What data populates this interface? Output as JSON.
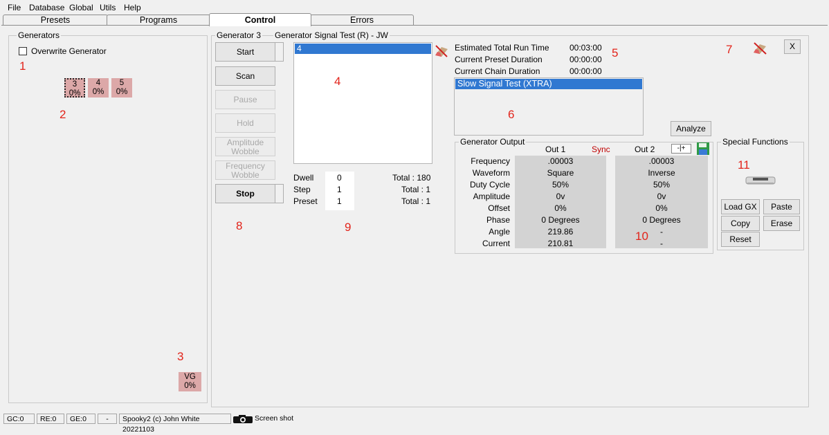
{
  "menu": [
    "File",
    "Database",
    "Global",
    "Utils",
    "Help"
  ],
  "tabs": [
    "Presets",
    "Programs",
    "Control",
    "Errors"
  ],
  "generators_panel": {
    "title": "Generators",
    "overwrite_label": "Overwrite Generator",
    "tiles": [
      {
        "num": "3",
        "pct": "0%"
      },
      {
        "num": "4",
        "pct": "0%"
      },
      {
        "num": "5",
        "pct": "0%"
      }
    ],
    "vg": {
      "num": "VG",
      "pct": "0%"
    }
  },
  "control": {
    "generator_title": "Generator 3",
    "program_title": "Generator Signal Test (R) - JW",
    "buttons": {
      "start": "Start",
      "scan": "Scan",
      "pause": "Pause",
      "hold": "Hold",
      "amp_1": "Amplitude",
      "amp_2": "Wobble",
      "freq_1": "Frequency",
      "freq_2": "Wobble",
      "stop": "Stop"
    },
    "list_selected": "4",
    "counters": {
      "dwell_label": "Dwell",
      "dwell_value": "0",
      "dwell_total": "Total : 180",
      "step_label": "Step",
      "step_value": "1",
      "step_total": "Total : 1",
      "preset_label": "Preset",
      "preset_value": "1",
      "preset_total": "Total : 1"
    }
  },
  "runtime": {
    "total_label": "Estimated Total Run Time",
    "total_value": "00:03:00",
    "preset_label": "Current Preset Duration",
    "preset_value": "00:00:00",
    "chain_label": "Current Chain Duration",
    "chain_value": "00:00:00",
    "chain_selected": "Slow Signal Test (XTRA)",
    "analyze": "Analyze",
    "close": "X"
  },
  "output": {
    "title": "Generator Output",
    "out1": "Out 1",
    "sync": "Sync",
    "out2": "Out 2",
    "minus_plus": "-|+",
    "rows": [
      {
        "label": "Frequency",
        "v1": ".00003",
        "v2": ".00003"
      },
      {
        "label": "Waveform",
        "v1": "Square",
        "v2": "Inverse"
      },
      {
        "label": "Duty Cycle",
        "v1": "50%",
        "v2": "50%"
      },
      {
        "label": "Amplitude",
        "v1": "0v",
        "v2": "0v"
      },
      {
        "label": "Offset",
        "v1": "0%",
        "v2": "0%"
      },
      {
        "label": "Phase",
        "v1": "0 Degrees",
        "v2": "0 Degrees"
      },
      {
        "label": "Angle",
        "v1": "219.86",
        "v2": "-"
      },
      {
        "label": "Current",
        "v1": "210.81",
        "v2": "-"
      }
    ]
  },
  "special": {
    "title": "Special Functions",
    "load": "Load GX",
    "paste": "Paste",
    "copy": "Copy",
    "erase": "Erase",
    "reset": "Reset"
  },
  "annotations": [
    "1",
    "2",
    "3",
    "4",
    "5",
    "6",
    "7",
    "8",
    "9",
    "10",
    "11"
  ],
  "status": {
    "gc": "GC:0",
    "re": "RE:0",
    "ge": "GE:0",
    "dash": "-",
    "credit": "Spooky2 (c) John White 20221103",
    "screenshot": "Screen shot"
  },
  "icons": {
    "erase": "eraser-icon",
    "save": "save-icon",
    "device": "device-icon",
    "camera": "camera-icon",
    "checkbox": "checkbox-icon"
  },
  "colors": {
    "selection": "#3078d1",
    "tile": "#dca8a8",
    "annotation": "#e2231a",
    "sync": "#c00000"
  }
}
